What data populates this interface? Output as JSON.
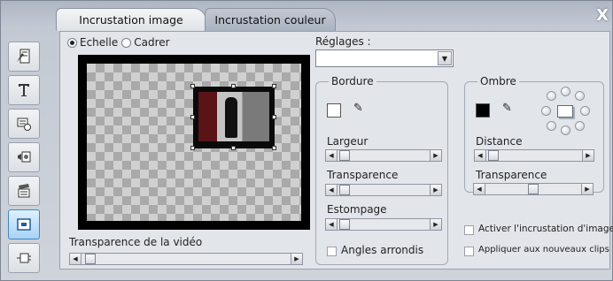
{
  "tabs": [
    {
      "label": "Incrustation image"
    },
    {
      "label": "Incrustation couleur"
    }
  ],
  "close_icon": "X",
  "toolbar_icons": [
    "title-editor-icon",
    "text-icon",
    "menu-icon",
    "sound-icon",
    "clapperboard-icon",
    "overlay-icon",
    "plugin-icon"
  ],
  "mode": {
    "options": [
      "Echelle",
      "Cadrer"
    ],
    "selected": "Echelle"
  },
  "reglages": {
    "label": "Réglages :",
    "value": ""
  },
  "video_transparency_label": "Transparence de la vidéo",
  "video_transparency_value": 0.02,
  "bordure": {
    "title": "Bordure",
    "color": "#ffffff",
    "largeur_label": "Largeur",
    "largeur_value": 0.02,
    "transparence_label": "Transparence",
    "transparence_value": 0.02,
    "estompage_label": "Estompage",
    "estompage_value": 0.02,
    "angles_label": "Angles arrondis",
    "angles_checked": false
  },
  "ombre": {
    "title": "Ombre",
    "color": "#000000",
    "distance_label": "Distance",
    "distance_value": 0.02,
    "transparence_label": "Transparence",
    "transparence_value": 0.5
  },
  "activate_label": "Activer l'incrustation d'image",
  "activate_checked": false,
  "apply_label": "Appliquer aux nouveaux clips",
  "apply_checked": false
}
